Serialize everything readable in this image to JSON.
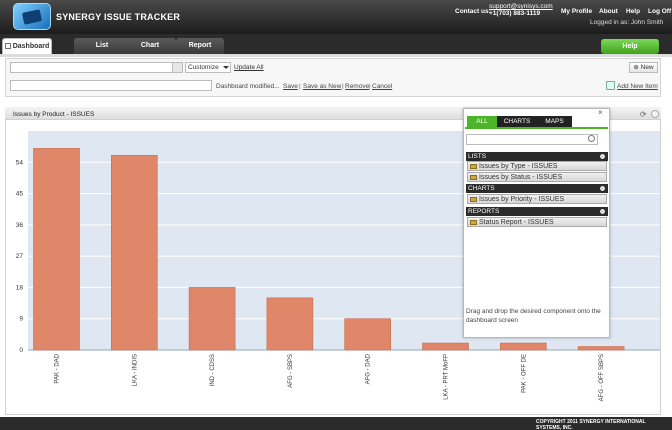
{
  "header": {
    "app_title": "SYNERGY ISSUE TRACKER",
    "contact_label": "Contact us:",
    "contact_email": "support@synisys.com",
    "contact_phone": "+1(703) 883-1119",
    "links": [
      "My Profile",
      "About",
      "Help",
      "Log Off"
    ],
    "logged_in": "Logged in as: John Smith"
  },
  "tabs": [
    "Dashboard",
    "List",
    "Chart",
    "Report"
  ],
  "help_button": "Help",
  "toolbar": {
    "customize": "Customize",
    "update_all": "Update All",
    "new": "New",
    "dashboard_modified": "Dashboard modified...",
    "save": "Save",
    "save_as_new": "Save as New",
    "remove": "Remove",
    "cancel": "Cancel",
    "add_new_item": "Add New Item"
  },
  "panel": {
    "title": "Issues by Product - ISSUES"
  },
  "palette": {
    "tabs": [
      "ALL",
      "CHARTS",
      "MAPS"
    ],
    "groups": [
      {
        "name": "LISTS",
        "items": [
          "Issues by Type - ISSUES",
          "Issues by Status - ISSUES"
        ]
      },
      {
        "name": "CHARTS",
        "items": [
          "Issues by Priority - ISSUES"
        ]
      },
      {
        "name": "REPORTS",
        "items": [
          "Status Report - ISSUES"
        ]
      }
    ],
    "drop_text": "Drag and drop the desired component onto the dashboard screen"
  },
  "chart_data": {
    "type": "bar",
    "categories": [
      "PAK - DAD",
      "LKA - INDIS",
      "IND - CDSS",
      "AFG - SBPS",
      "AFG - DAD",
      "LKA - PRT MoFP",
      "PAK - OFF DE",
      "AFG - OFF SBPS"
    ],
    "values": [
      58,
      56,
      18,
      15,
      9,
      2,
      2,
      1
    ],
    "yticks": [
      0,
      9,
      18,
      27,
      36,
      45,
      54
    ],
    "ylim": [
      0,
      63
    ],
    "grid": true,
    "colors": {
      "bar": "#e0876a",
      "bar_dark": "#c96a4d",
      "plot_bg": "#dfe7f3",
      "grid": "#ffffff"
    }
  },
  "footer": {
    "copyright": "COPYRIGHT 2011 SYNERGY INTERNATIONAL SYSTEMS, INC."
  }
}
